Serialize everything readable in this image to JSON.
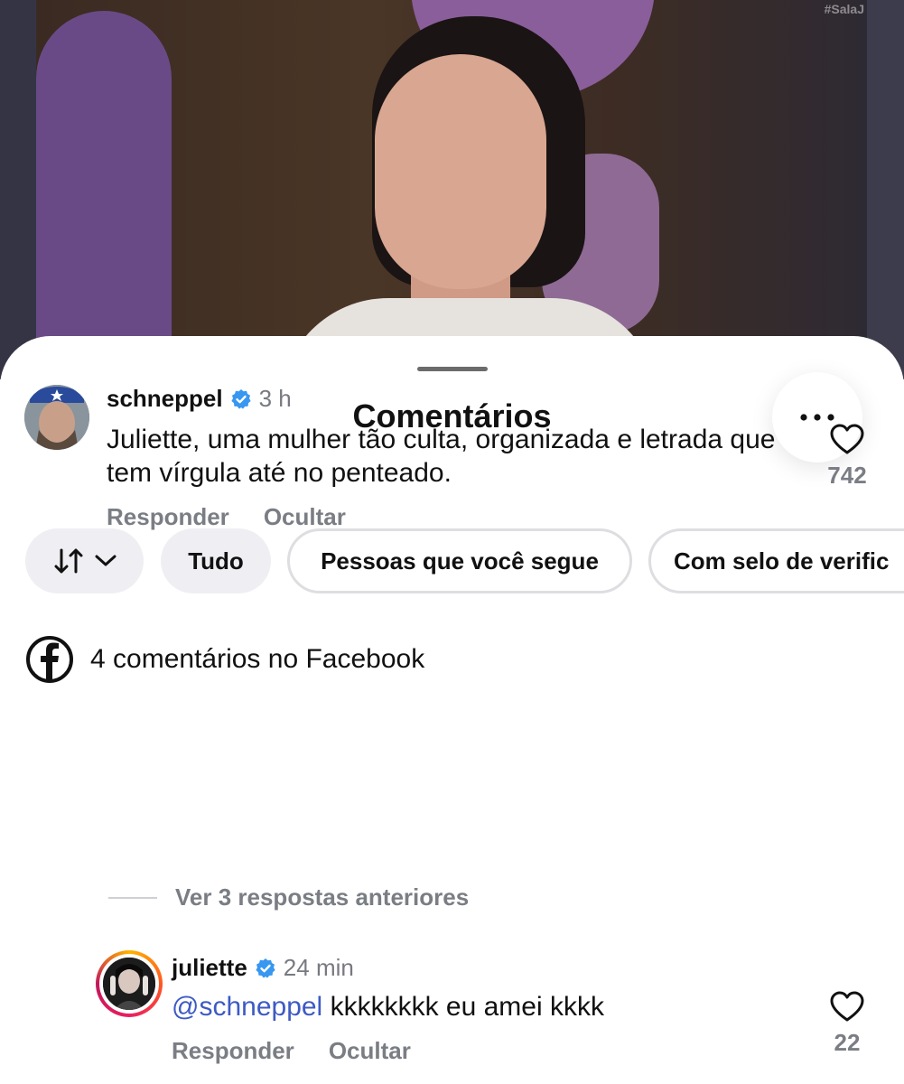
{
  "video": {
    "watermark": "#SalaJ"
  },
  "sheet": {
    "title": "Comentários",
    "more_icon": "more-horizontal-icon"
  },
  "filters": {
    "sort_icon": "sort-arrows-icon",
    "chips": [
      "Tudo",
      "Pessoas que você segue",
      "Com selo de verific"
    ]
  },
  "facebook": {
    "icon": "facebook-icon",
    "text": "4 comentários no Facebook"
  },
  "comments": [
    {
      "username": "schneppel",
      "verified": true,
      "time": "3 h",
      "text": "Juliette, uma mulher tão culta, organizada e letrada que tem vírgula até no penteado.",
      "likes": "742",
      "reply_label": "Responder",
      "hide_label": "Ocultar"
    }
  ],
  "view_replies": "Ver 3 respostas anteriores",
  "replies": [
    {
      "username": "juliette",
      "verified": true,
      "time": "24 min",
      "mention": "@schneppel",
      "text": " kkkkkkkk eu amei kkkk",
      "likes": "22",
      "reply_label": "Responder",
      "hide_label": "Ocultar"
    }
  ],
  "colors": {
    "mention": "#3d5ac4",
    "verified_badge": "#3897f0",
    "secondary_text": "#7a7e84"
  }
}
